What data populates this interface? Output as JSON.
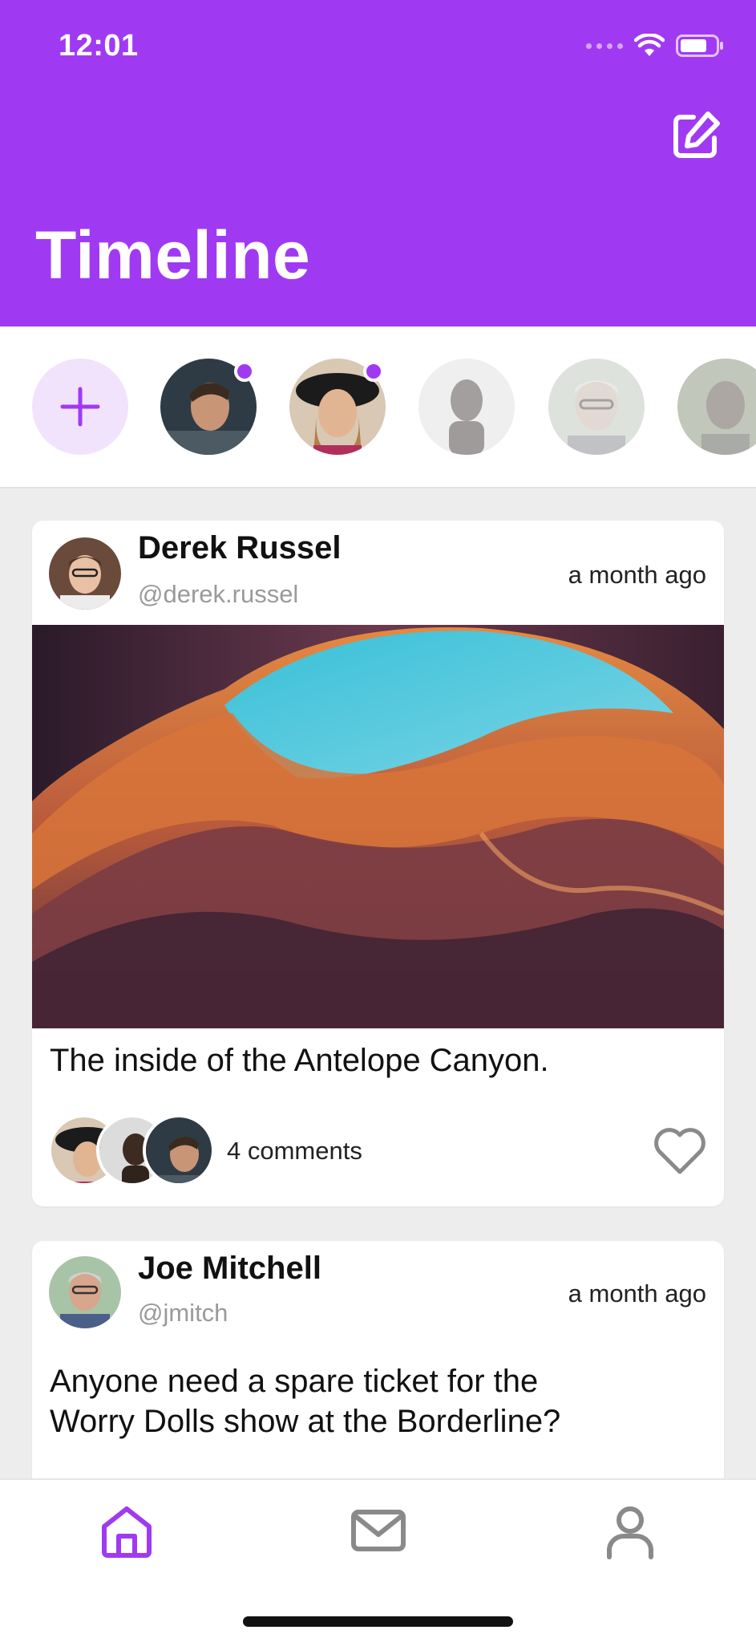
{
  "status_bar": {
    "time": "12:01"
  },
  "header": {
    "title": "Timeline",
    "accent": "#a03af2"
  },
  "stories": [
    {
      "name": "add-story",
      "unread": false
    },
    {
      "name": "story-1",
      "unread": true
    },
    {
      "name": "story-2",
      "unread": true
    },
    {
      "name": "story-3",
      "unread": false
    },
    {
      "name": "story-4",
      "unread": false
    },
    {
      "name": "story-5",
      "unread": false
    }
  ],
  "posts": [
    {
      "author": "Derek Russel",
      "handle": "@derek.russel",
      "time": "a month ago",
      "caption": "The inside of the Antelope Canyon.",
      "comments_label": "4 comments",
      "liked": false
    },
    {
      "author": "Joe Mitchell",
      "handle": "@jmitch",
      "time": "a month ago",
      "caption_line1": "Anyone need a spare ticket for the",
      "caption_line2": "Worry Dolls show at the Borderline?"
    }
  ],
  "tabbar": {
    "items": [
      {
        "icon": "home-icon",
        "active": true
      },
      {
        "icon": "mail-icon",
        "active": false
      },
      {
        "icon": "user-icon",
        "active": false
      }
    ]
  }
}
